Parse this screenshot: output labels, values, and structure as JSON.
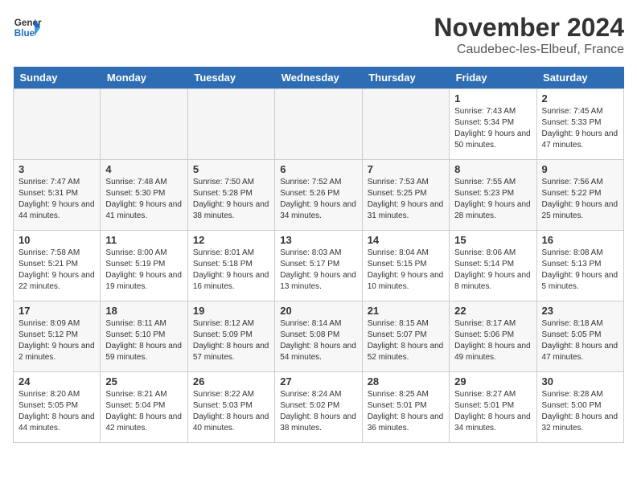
{
  "header": {
    "logo_line1": "General",
    "logo_line2": "Blue",
    "month": "November 2024",
    "location": "Caudebec-les-Elbeuf, France"
  },
  "weekdays": [
    "Sunday",
    "Monday",
    "Tuesday",
    "Wednesday",
    "Thursday",
    "Friday",
    "Saturday"
  ],
  "weeks": [
    [
      {
        "day": "",
        "empty": true
      },
      {
        "day": "",
        "empty": true
      },
      {
        "day": "",
        "empty": true
      },
      {
        "day": "",
        "empty": true
      },
      {
        "day": "",
        "empty": true
      },
      {
        "day": "1",
        "sunrise": "7:43 AM",
        "sunset": "5:34 PM",
        "daylight": "9 hours and 50 minutes."
      },
      {
        "day": "2",
        "sunrise": "7:45 AM",
        "sunset": "5:33 PM",
        "daylight": "9 hours and 47 minutes."
      }
    ],
    [
      {
        "day": "3",
        "sunrise": "7:47 AM",
        "sunset": "5:31 PM",
        "daylight": "9 hours and 44 minutes."
      },
      {
        "day": "4",
        "sunrise": "7:48 AM",
        "sunset": "5:30 PM",
        "daylight": "9 hours and 41 minutes."
      },
      {
        "day": "5",
        "sunrise": "7:50 AM",
        "sunset": "5:28 PM",
        "daylight": "9 hours and 38 minutes."
      },
      {
        "day": "6",
        "sunrise": "7:52 AM",
        "sunset": "5:26 PM",
        "daylight": "9 hours and 34 minutes."
      },
      {
        "day": "7",
        "sunrise": "7:53 AM",
        "sunset": "5:25 PM",
        "daylight": "9 hours and 31 minutes."
      },
      {
        "day": "8",
        "sunrise": "7:55 AM",
        "sunset": "5:23 PM",
        "daylight": "9 hours and 28 minutes."
      },
      {
        "day": "9",
        "sunrise": "7:56 AM",
        "sunset": "5:22 PM",
        "daylight": "9 hours and 25 minutes."
      }
    ],
    [
      {
        "day": "10",
        "sunrise": "7:58 AM",
        "sunset": "5:21 PM",
        "daylight": "9 hours and 22 minutes."
      },
      {
        "day": "11",
        "sunrise": "8:00 AM",
        "sunset": "5:19 PM",
        "daylight": "9 hours and 19 minutes."
      },
      {
        "day": "12",
        "sunrise": "8:01 AM",
        "sunset": "5:18 PM",
        "daylight": "9 hours and 16 minutes."
      },
      {
        "day": "13",
        "sunrise": "8:03 AM",
        "sunset": "5:17 PM",
        "daylight": "9 hours and 13 minutes."
      },
      {
        "day": "14",
        "sunrise": "8:04 AM",
        "sunset": "5:15 PM",
        "daylight": "9 hours and 10 minutes."
      },
      {
        "day": "15",
        "sunrise": "8:06 AM",
        "sunset": "5:14 PM",
        "daylight": "9 hours and 8 minutes."
      },
      {
        "day": "16",
        "sunrise": "8:08 AM",
        "sunset": "5:13 PM",
        "daylight": "9 hours and 5 minutes."
      }
    ],
    [
      {
        "day": "17",
        "sunrise": "8:09 AM",
        "sunset": "5:12 PM",
        "daylight": "9 hours and 2 minutes."
      },
      {
        "day": "18",
        "sunrise": "8:11 AM",
        "sunset": "5:10 PM",
        "daylight": "8 hours and 59 minutes."
      },
      {
        "day": "19",
        "sunrise": "8:12 AM",
        "sunset": "5:09 PM",
        "daylight": "8 hours and 57 minutes."
      },
      {
        "day": "20",
        "sunrise": "8:14 AM",
        "sunset": "5:08 PM",
        "daylight": "8 hours and 54 minutes."
      },
      {
        "day": "21",
        "sunrise": "8:15 AM",
        "sunset": "5:07 PM",
        "daylight": "8 hours and 52 minutes."
      },
      {
        "day": "22",
        "sunrise": "8:17 AM",
        "sunset": "5:06 PM",
        "daylight": "8 hours and 49 minutes."
      },
      {
        "day": "23",
        "sunrise": "8:18 AM",
        "sunset": "5:05 PM",
        "daylight": "8 hours and 47 minutes."
      }
    ],
    [
      {
        "day": "24",
        "sunrise": "8:20 AM",
        "sunset": "5:05 PM",
        "daylight": "8 hours and 44 minutes."
      },
      {
        "day": "25",
        "sunrise": "8:21 AM",
        "sunset": "5:04 PM",
        "daylight": "8 hours and 42 minutes."
      },
      {
        "day": "26",
        "sunrise": "8:22 AM",
        "sunset": "5:03 PM",
        "daylight": "8 hours and 40 minutes."
      },
      {
        "day": "27",
        "sunrise": "8:24 AM",
        "sunset": "5:02 PM",
        "daylight": "8 hours and 38 minutes."
      },
      {
        "day": "28",
        "sunrise": "8:25 AM",
        "sunset": "5:01 PM",
        "daylight": "8 hours and 36 minutes."
      },
      {
        "day": "29",
        "sunrise": "8:27 AM",
        "sunset": "5:01 PM",
        "daylight": "8 hours and 34 minutes."
      },
      {
        "day": "30",
        "sunrise": "8:28 AM",
        "sunset": "5:00 PM",
        "daylight": "8 hours and 32 minutes."
      }
    ]
  ]
}
